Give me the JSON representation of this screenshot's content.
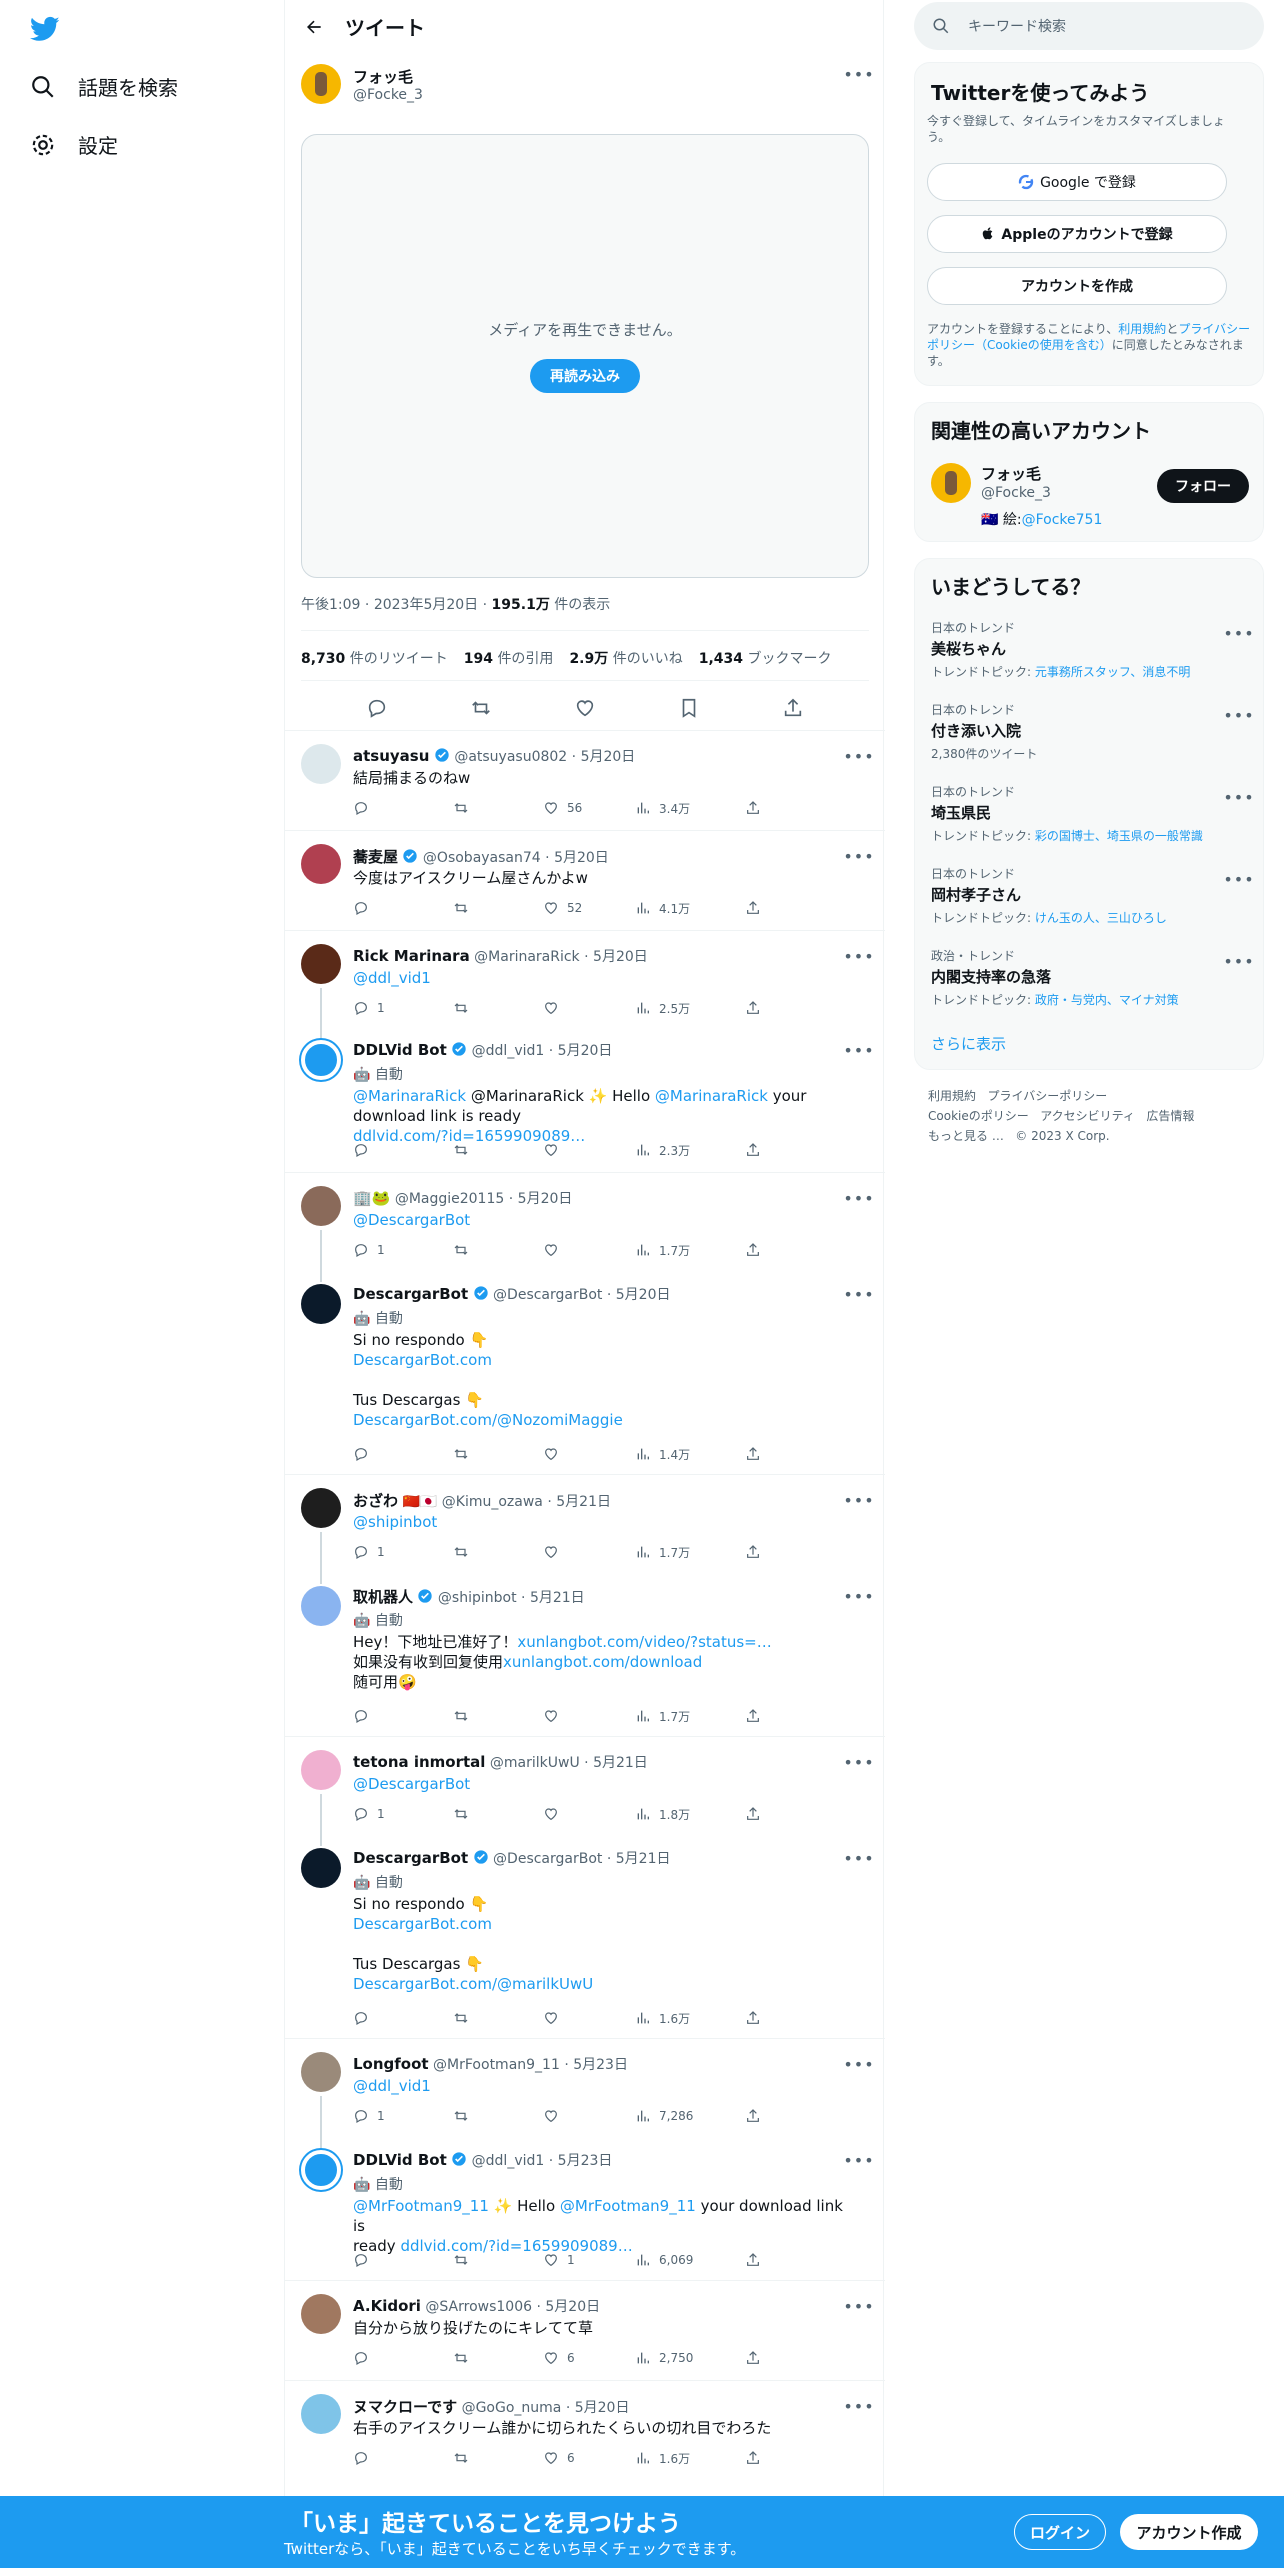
{
  "nav": {
    "search_label": "話題を検索",
    "settings_label": "設定"
  },
  "header": {
    "title": "ツイート"
  },
  "tweet": {
    "author_name": "フォッ毛",
    "author_handle": "@Focke_3",
    "media_message": "メディアを再生できません。",
    "media_reload": "再読み込み",
    "time": "午後1:09",
    "date": "2023年5月20日",
    "views": "195.1万",
    "views_label": "件の表示",
    "retweets": "8,730",
    "retweets_label": "件のリツイート",
    "quotes": "194",
    "quotes_label": "件の引用",
    "likes": "2.9万",
    "likes_label": "件のいいね",
    "bookmarks": "1,434",
    "bookmarks_label": "ブックマーク"
  },
  "replies": [
    {
      "name": "atsuyasu",
      "handle": "@atsuyasu0802",
      "date": "5月20日",
      "text": "結局捕まるのねw",
      "replies": "",
      "likes": "56",
      "views": "3.4万"
    },
    {
      "name": "蕎麦屋",
      "handle": "@Osobayasan74",
      "date": "5月20日",
      "text": "今度はアイスクリーム屋さんかよw",
      "replies": "",
      "likes": "52",
      "views": "4.1万"
    },
    {
      "name": "Rick Marinara",
      "handle": "@MarinaraRick",
      "date": "5月20日",
      "text": "@ddl_vid1",
      "replies": "1",
      "likes": "",
      "views": "2.5万"
    },
    {
      "name": "DDLVid Bot",
      "handle": "@ddl_vid1",
      "date": "5月20日",
      "auto": "自動",
      "text1": "@MarinaraRick ✨ Hello ",
      "mention": "@MarinaraRick",
      "text2": " your download link is ready",
      "link": "ddlvid.com/?id=1659909089…",
      "replies": "",
      "likes": "",
      "views": "2.3万"
    },
    {
      "name": "",
      "handle": "@Maggie20115",
      "date": "5月20日",
      "text": "@DescargarBot",
      "replies": "1",
      "likes": "",
      "views": "1.7万"
    },
    {
      "name": "DescargarBot",
      "handle": "@DescargarBot",
      "date": "5月20日",
      "auto": "自動",
      "line1": "Si no respondo 👇",
      "link1": "DescargarBot.com",
      "line2": "Tus Descargas 👇",
      "link2": "DescargarBot.com/@NozomiMaggie",
      "replies": "",
      "likes": "",
      "views": "1.4万"
    },
    {
      "name": "おざわ",
      "handle": "@Kimu_ozawa",
      "date": "5月21日",
      "text": "@shipinbot",
      "replies": "1",
      "likes": "",
      "views": "1.7万"
    },
    {
      "name": "取机器人",
      "handle": "@shipinbot",
      "date": "5月21日",
      "auto": "自動",
      "line1": "Hey！下地址已准好了！",
      "link1": "xunlangbot.com/video/?status=…",
      "line2": "如果没有收到回复使用",
      "link2": "xunlangbot.com/download",
      "line3": "随可用🤪",
      "replies": "",
      "likes": "",
      "views": "1.7万"
    },
    {
      "name": "tetona inmortal",
      "handle": "@marilkUwU",
      "date": "5月21日",
      "text": "@DescargarBot",
      "replies": "1",
      "likes": "",
      "views": "1.8万"
    },
    {
      "name": "DescargarBot",
      "handle": "@DescargarBot",
      "date": "5月21日",
      "auto": "自動",
      "line1": "Si no respondo 👇",
      "link1": "DescargarBot.com",
      "line2": "Tus Descargas 👇",
      "link2": "DescargarBot.com/@marilkUwU",
      "replies": "",
      "likes": "",
      "views": "1.6万"
    },
    {
      "name": "Longfoot",
      "handle": "@MrFootman9_11",
      "date": "5月23日",
      "text": "@ddl_vid1",
      "replies": "1",
      "likes": "",
      "views": "7,286"
    },
    {
      "name": "DDLVid Bot",
      "handle": "@ddl_vid1",
      "date": "5月23日",
      "auto": "自動",
      "text1": "",
      "mention1": "@MrFootman9_11",
      "text2": " ✨ Hello ",
      "mention": "@MrFootman9_11",
      "text3": " your download link is",
      "text4": "ready ",
      "link": "ddlvid.com/?id=1659909089…",
      "replies": "",
      "likes": "1",
      "views": "6,069"
    },
    {
      "name": "A.Kidori",
      "handle": "@SArrows1006",
      "date": "5月20日",
      "text": "自分から放り投げたのにキレてて草",
      "replies": "",
      "likes": "6",
      "views": "2,750"
    },
    {
      "name": "ヌマクローです",
      "handle": "@GoGo_numa",
      "date": "5月20日",
      "text": "右手のアイスクリーム誰かに切られたくらいの切れ目でわろた",
      "replies": "",
      "likes": "6",
      "views": "1.6万"
    }
  ],
  "sidebar": {
    "search_placeholder": "キーワード検索",
    "signup": {
      "title": "Twitterを使ってみよう",
      "subtitle": "今すぐ登録して、タイムラインをカスタマイズしましょう。",
      "google": "Google で登録",
      "apple": "Appleのアカウントで登録",
      "create": "アカウントを作成",
      "legal_pre": "アカウントを登録することにより、",
      "legal_terms": "利用規約",
      "legal_and": "と",
      "legal_privacy": "プライバシーポリシー",
      "legal_cookie": "（Cookieの使用を含む）",
      "legal_post": "に同意したとみなされます。"
    },
    "related": {
      "title": "関連性の高いアカウント",
      "name": "フォッ毛",
      "handle": "@Focke_3",
      "bio_pre": "🇦🇺 絵:",
      "bio_link": "@Focke751",
      "follow": "フォロー"
    },
    "trends": {
      "title": "いまどうしてる？",
      "items": [
        {
          "cat": "日本のトレンド",
          "title": "美桜ちゃん",
          "sub_pre": "トレンドトピック: ",
          "sub_links": "元事務所スタッフ、消息不明"
        },
        {
          "cat": "日本のトレンド",
          "title": "付き添い入院",
          "sub_pre": "2,380件のツイート",
          "sub_links": ""
        },
        {
          "cat": "日本のトレンド",
          "title": "埼玉県民",
          "sub_pre": "トレンドトピック: ",
          "sub_links": "彩の国博士、埼玉県の一般常識"
        },
        {
          "cat": "日本のトレンド",
          "title": "岡村孝子さん",
          "sub_pre": "トレンドトピック: ",
          "sub_links": "けん玉の人、三山ひろし"
        },
        {
          "cat": "政治・トレンド",
          "title": "内閣支持率の急落",
          "sub_pre": "トレンドトピック: ",
          "sub_links": "政府・与党内、マイナ対策"
        }
      ],
      "more": "さらに表示"
    },
    "footer": {
      "l1": "利用規約",
      "l2": "プライバシーポリシー",
      "l3": "Cookieのポリシー",
      "l4": "アクセシビリティ",
      "l5": "広告情報",
      "l6": "もっと見る …",
      "copyright": "© 2023 X Corp."
    }
  },
  "bottombar": {
    "title": "「いま」起きていることを見つけよう",
    "subtitle": "Twitterなら、「いま」起きていることをいち早くチェックできます。",
    "login": "ログイン",
    "signup": "アカウント作成"
  }
}
